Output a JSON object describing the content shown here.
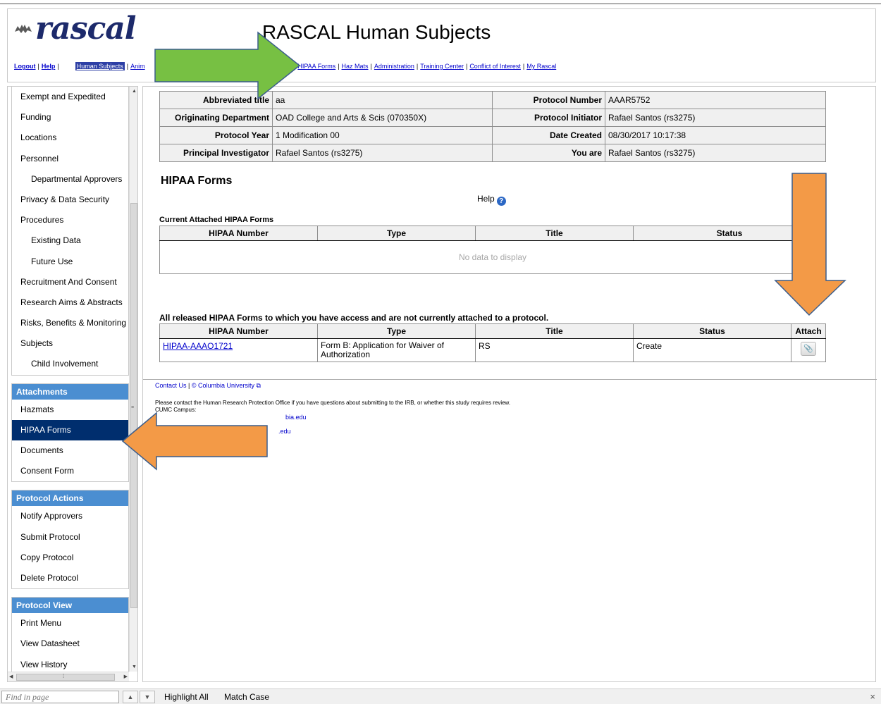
{
  "header": {
    "logo_text": "rascal",
    "title": "RASCAL Human Subjects",
    "nav_left": [
      "Logout",
      "Help"
    ],
    "nav_current": "Human Subjects",
    "nav_partial": "Anim",
    "nav_right": [
      "HIPAA Forms",
      "Haz Mats",
      "Administration",
      "Training Center",
      "Conflict of Interest",
      "My Rascal"
    ]
  },
  "sidebar": {
    "items": [
      {
        "label": "Exempt and Expedited",
        "sub": false
      },
      {
        "label": "Funding",
        "sub": false
      },
      {
        "label": "Locations",
        "sub": false
      },
      {
        "label": "Personnel",
        "sub": false
      },
      {
        "label": "Departmental Approvers",
        "sub": true
      },
      {
        "label": "Privacy & Data Security",
        "sub": false
      },
      {
        "label": "Procedures",
        "sub": false
      },
      {
        "label": "Existing Data",
        "sub": true
      },
      {
        "label": "Future Use",
        "sub": true
      },
      {
        "label": "Recruitment And Consent",
        "sub": false
      },
      {
        "label": "Research Aims & Abstracts",
        "sub": false
      },
      {
        "label": "Risks, Benefits & Monitoring",
        "sub": false
      },
      {
        "label": "Subjects",
        "sub": false
      },
      {
        "label": "Child Involvement",
        "sub": true
      }
    ],
    "attachments": {
      "heading": "Attachments",
      "items": [
        "Hazmats",
        "HIPAA Forms",
        "Documents",
        "Consent Form"
      ],
      "selected": "HIPAA Forms"
    },
    "protocol_actions": {
      "heading": "Protocol Actions",
      "items": [
        "Notify Approvers",
        "Submit Protocol",
        "Copy Protocol",
        "Delete Protocol"
      ]
    },
    "protocol_view": {
      "heading": "Protocol View",
      "items": [
        "Print Menu",
        "View Datasheet",
        "View History"
      ]
    }
  },
  "protocol_info": {
    "abbreviated_title": {
      "label": "Abbreviated title",
      "value": "aa"
    },
    "protocol_number": {
      "label": "Protocol Number",
      "value": "AAAR5752"
    },
    "originating_department": {
      "label": "Originating Department",
      "value": "OAD College and Arts & Scis (070350X)"
    },
    "protocol_initiator": {
      "label": "Protocol Initiator",
      "value": "Rafael Santos (rs3275)"
    },
    "protocol_year": {
      "label": "Protocol Year",
      "value": "1 Modification 00"
    },
    "date_created": {
      "label": "Date Created",
      "value": "08/30/2017 10:17:38"
    },
    "principal_investigator": {
      "label": "Principal Investigator",
      "value": "Rafael Santos (rs3275)"
    },
    "you_are": {
      "label": "You are",
      "value": "Rafael Santos (rs3275)"
    }
  },
  "hipaa": {
    "title": "HIPAA Forms",
    "help_label": "Help",
    "current": {
      "caption": "Current Attached HIPAA Forms",
      "columns": [
        "HIPAA Number",
        "Type",
        "Title",
        "Status"
      ],
      "empty_text": "No data to display"
    },
    "available": {
      "caption": "All released HIPAA Forms to which you have access and are not currently attached to a protocol.",
      "columns": [
        "HIPAA Number",
        "Type",
        "Title",
        "Status",
        "Attach"
      ],
      "rows": [
        {
          "number": "HIPAA-AAAO1721",
          "type": "Form B: Application for Waiver of Authorization",
          "title": "RS",
          "status": "Create"
        }
      ]
    }
  },
  "footer": {
    "contact": "Contact Us",
    "university": "© Columbia University",
    "notice": "Please contact the Human Research Protection Office if you have questions about submitting to the IRB, or whether this study requires review.",
    "campus": "CUMC Campus:",
    "email_fragment_1": "bia.edu",
    "email_fragment_2": ".edu"
  },
  "findbar": {
    "placeholder": "Find in page",
    "highlight_all": "Highlight All",
    "match_case": "Match Case"
  },
  "colors": {
    "sidebar_heading": "#4b8ed1",
    "sidebar_selected": "#002e6e",
    "arrow_green": "#77c043",
    "arrow_orange": "#f39a47",
    "link": "#0000cc"
  }
}
